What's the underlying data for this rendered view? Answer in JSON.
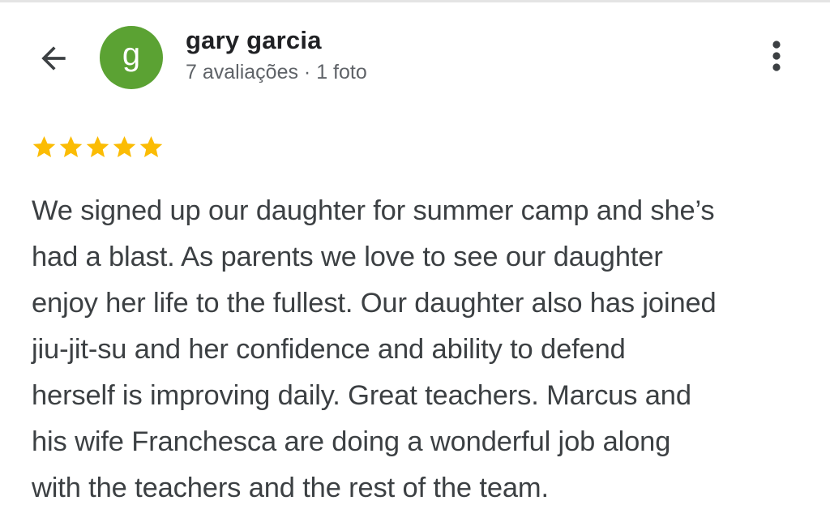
{
  "header": {
    "back_icon": "arrow-left-icon",
    "more_icon": "more-vertical-icon"
  },
  "reviewer": {
    "avatar_letter": "g",
    "avatar_color": "#5ba233",
    "name": "gary garcia",
    "meta": "7 avaliações · 1 foto"
  },
  "review": {
    "rating": 5,
    "max_rating": 5,
    "star_color": "#fbbc04",
    "lines": [
      "We signed up our daughter for summer camp and she’s",
      "had a blast. As parents we love to see our daughter",
      "enjoy her life to the fullest. Our daughter also has joined",
      "jiu-jit-su and her confidence and ability to defend",
      "herself is improving daily. Great teachers. Marcus and",
      "his wife Franchesca are doing a wonderful job along",
      "with the teachers and the rest of the team."
    ]
  }
}
